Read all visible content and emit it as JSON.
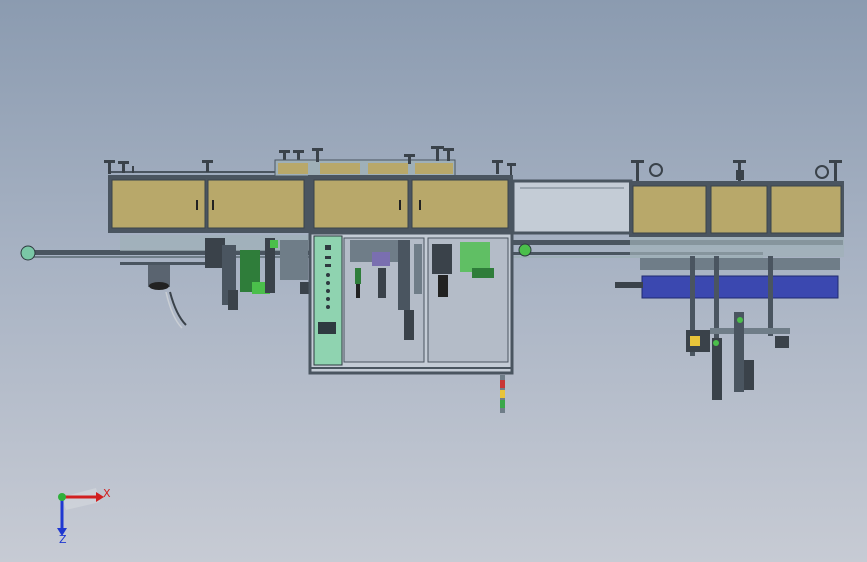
{
  "model_view": {
    "title": "",
    "description_visible": false
  },
  "triad": {
    "x_label": "X",
    "y_label": "Z",
    "colors": {
      "x": "#d11f1f",
      "y": "#2fb03a",
      "z": "#1f38d1"
    }
  },
  "colors": {
    "background_top": "#8b9bb0",
    "background_bottom": "#c7cbd4",
    "panel_fill": "#b8a86a",
    "frame": "#4a5560",
    "frame_light": "#9fb0b8",
    "glass": "#c4ccd6",
    "control_panel": "#8fd3b0",
    "blue_unit": "#3b48b0",
    "green_part": "#4bbf4b"
  }
}
